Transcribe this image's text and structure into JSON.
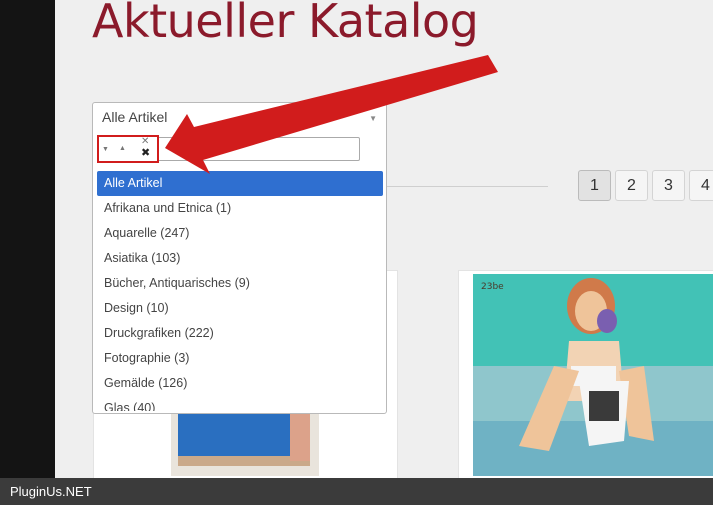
{
  "page": {
    "title": "Aktueller Katalog"
  },
  "filter": {
    "selected_label": "Alle Artikel",
    "search_value": "",
    "options": [
      "Alle Artikel",
      "Afrikana und Etnica (1)",
      "Aquarelle (247)",
      "Asiatika (103)",
      "Bücher, Antiquarisches (9)",
      "Design (10)",
      "Druckgrafiken (222)",
      "Fotographie (3)",
      "Gemälde (126)",
      "Glas (40)"
    ],
    "highlighted_index": 0
  },
  "pagination": {
    "pages": [
      "1",
      "2",
      "3",
      "4"
    ],
    "current": "1"
  },
  "cards": [
    {
      "image": "catalog-artwork-blue-figure"
    },
    {
      "image": "catalog-artwork-seated-woman",
      "signature": "23be"
    }
  ],
  "footer": {
    "text": "PluginUs.NET"
  },
  "colors": {
    "title": "#8b1a2b",
    "highlight": "#2f6fd0",
    "annotation": "#d11c1c",
    "footer_bg": "#3b3b3b"
  }
}
